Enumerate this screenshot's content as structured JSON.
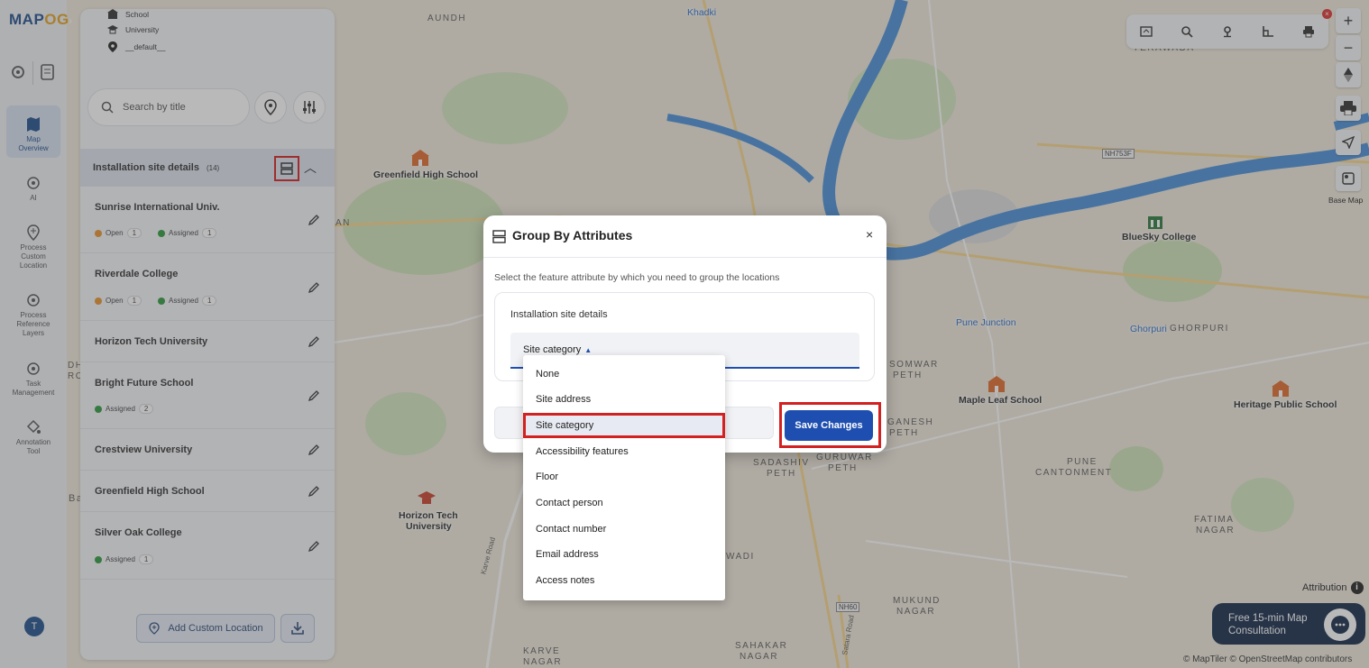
{
  "app": {
    "logo_text_1": "MAP",
    "logo_text_2": "OG"
  },
  "rail": {
    "items": [
      {
        "label_1": "Map",
        "label_2": "Overview"
      },
      {
        "label_1": "AI",
        "label_2": ""
      },
      {
        "label_1": "Process",
        "label_2": "Custom",
        "label_3": "Location"
      },
      {
        "label_1": "Process",
        "label_2": "Reference",
        "label_3": "Layers"
      },
      {
        "label_1": "Task",
        "label_2": "Management"
      },
      {
        "label_1": "Annotation",
        "label_2": "Tool"
      }
    ],
    "avatar_initial": "T"
  },
  "panel": {
    "legend": [
      "School",
      "University",
      "__default__"
    ],
    "search_placeholder": "Search by title",
    "group_title": "Installation site details",
    "group_count": "(14)",
    "items": [
      {
        "title": "Sunrise International Univ.",
        "badges": [
          {
            "label": "Open",
            "count": "1",
            "color": "#e8932a"
          },
          {
            "label": "Assigned",
            "count": "1",
            "color": "#2e9a3e"
          }
        ]
      },
      {
        "title": "Riverdale College",
        "badges": [
          {
            "label": "Open",
            "count": "1",
            "color": "#e8932a"
          },
          {
            "label": "Assigned",
            "count": "1",
            "color": "#2e9a3e"
          }
        ]
      },
      {
        "title": "Horizon Tech University",
        "badges": []
      },
      {
        "title": "Bright Future School",
        "badges": [
          {
            "label": "Assigned",
            "count": "2",
            "color": "#2e9a3e"
          }
        ]
      },
      {
        "title": "Crestview University",
        "badges": []
      },
      {
        "title": "Greenfield High School",
        "badges": []
      },
      {
        "title": "Silver Oak College",
        "badges": [
          {
            "label": "Assigned",
            "count": "1",
            "color": "#2e9a3e"
          }
        ]
      }
    ],
    "add_location_label": "Add Custom Location"
  },
  "map": {
    "area_labels": [
      "AUNDH",
      "YERAWADA",
      "GHORPURI",
      "SOMWAR",
      "PETH",
      "GANESH",
      "PETH",
      "GURUWAR",
      "PETH",
      "SADASHIV",
      "PETH",
      "PUNE",
      "CANTONMENT",
      "FATIMA",
      "NAGAR",
      "MUKUND",
      "NAGAR",
      "SAHAKAR",
      "NAGAR",
      "KARVE",
      "NAGAR",
      "WADI",
      "AN",
      "DH",
      "RO",
      "Ba"
    ],
    "pois": [
      {
        "name": "Khadki"
      },
      {
        "name": "Greenfield High School"
      },
      {
        "name": "BlueSky College"
      },
      {
        "name": "Pune Junction"
      },
      {
        "name": "Ghorpuri"
      },
      {
        "name": "Maple Leaf School"
      },
      {
        "name": "Heritage Public School"
      },
      {
        "name": "Horizon Tech",
        "name2": "University"
      }
    ],
    "road_shields": [
      "NH753F",
      "NH60"
    ],
    "road_names": [
      "Karve Road",
      "Satara Road"
    ],
    "base_map_label": "Base Map",
    "attribution_label": "Attribution",
    "consult_line1": "Free 15-min Map",
    "consult_line2": "Consultation",
    "copyright": "© MapTiler © OpenStreetMap contributors"
  },
  "modal": {
    "title": "Group By Attributes",
    "description": "Select the feature attribute by which you need to group the locations",
    "card_label": "Installation site details",
    "selected_value": "Site category",
    "save_label": "Save Changes",
    "close_glyph": "×"
  },
  "dropdown": {
    "options": [
      "None",
      "Site address",
      "Site category",
      "Accessibility features",
      "Floor",
      "Contact person",
      "Contact number",
      "Email address",
      "Access notes"
    ],
    "selected_index": 2
  },
  "colors": {
    "accent": "#1e4fb0",
    "highlight": "#d32020",
    "river": "#4a8fd8",
    "brand": "#1f4e8c"
  }
}
